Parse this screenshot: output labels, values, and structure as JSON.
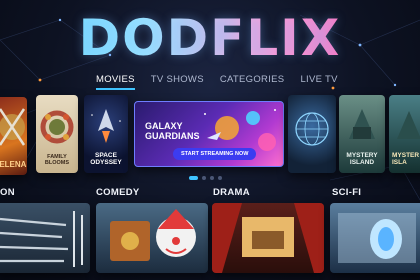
{
  "app": {
    "logo_text": "DODFLIX"
  },
  "nav": {
    "tabs": [
      {
        "label": "MOVIES",
        "active": true
      },
      {
        "label": "TV SHOWS",
        "active": false
      },
      {
        "label": "CATEGORIES",
        "active": false
      },
      {
        "label": "LIVE TV",
        "active": false
      }
    ]
  },
  "featured": {
    "posters": [
      {
        "title": "VELENA"
      },
      {
        "title": "FAMILY BLOOMS"
      },
      {
        "title": "SPACE ODYSSEY"
      },
      {
        "title": "MYSTERY ISLAND"
      },
      {
        "title": "MYSTER ISLA"
      }
    ],
    "hero": {
      "title_line1": "GALAXY",
      "title_line2": "GUARDIANS",
      "cta_label": "START STREAMING NOW"
    }
  },
  "categories": [
    {
      "label": "ON"
    },
    {
      "label": "COMEDY"
    },
    {
      "label": "DRAMA"
    },
    {
      "label": "SCI-FI"
    }
  ],
  "colors": {
    "accent": "#3fc4ff",
    "cta": "#3c3cf0",
    "logo_start": "#55d8ff",
    "logo_end": "#ff4fa8"
  }
}
